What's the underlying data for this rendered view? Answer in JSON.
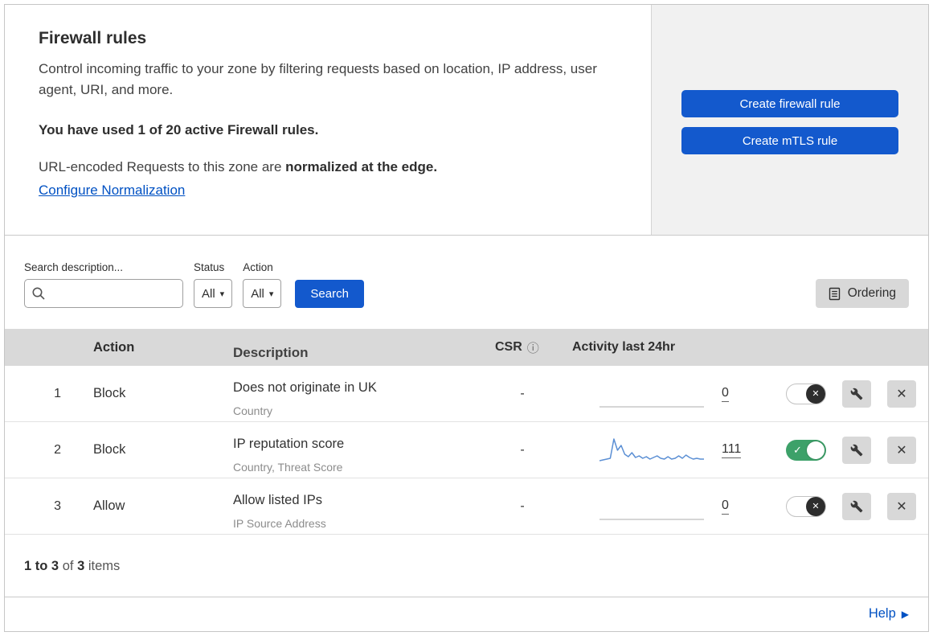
{
  "colors": {
    "primary_button": "#1359cd",
    "link": "#0051c3",
    "toggle_on": "#3da169",
    "sparkline": "#5b8fd4",
    "sparkline_flat": "#c9c9c9"
  },
  "icons": {
    "check": "✓",
    "x": "✕",
    "caret_down": "▾",
    "info": "ⓘ",
    "help_arrow": "▶"
  },
  "header": {
    "title": "Firewall rules",
    "description": "Control incoming traffic to your zone by filtering requests based on location, IP address, user agent, URI, and more.",
    "usage_note": "You have used 1 of 20 active Firewall rules.",
    "normalization_prefix": "URL-encoded Requests to this zone are ",
    "normalization_bold": "normalized at the edge.",
    "normalization_link": "Configure Normalization",
    "create_firewall_button": "Create firewall rule",
    "create_mtls_button": "Create mTLS rule"
  },
  "filters": {
    "search_label": "Search description...",
    "status_label": "Status",
    "status_value": "All",
    "action_label": "Action",
    "action_value": "All",
    "search_button": "Search",
    "ordering_button": "Ordering"
  },
  "table": {
    "headers": {
      "action": "Action",
      "description": "Description",
      "csr": "CSR",
      "activity": "Activity last 24hr"
    },
    "rows": [
      {
        "index": "1",
        "action": "Block",
        "description": "Does not originate in UK",
        "criteria": "Country",
        "csr": "-",
        "activity_count": "0",
        "enabled": false,
        "sparkline": [
          0,
          0,
          0,
          0,
          0,
          0,
          0,
          0,
          0,
          0,
          0,
          0,
          0,
          0,
          0,
          0,
          0,
          0,
          0,
          0
        ]
      },
      {
        "index": "2",
        "action": "Block",
        "description": "IP reputation score",
        "criteria": "Country, Threat Score",
        "csr": "-",
        "activity_count": "111",
        "enabled": true,
        "sparkline": [
          3,
          4,
          5,
          6,
          30,
          16,
          22,
          11,
          8,
          13,
          7,
          9,
          6,
          8,
          5,
          7,
          9,
          6,
          5,
          8,
          5,
          6,
          9,
          6,
          10,
          7,
          5,
          6,
          5,
          5
        ]
      },
      {
        "index": "3",
        "action": "Allow",
        "description": "Allow listed IPs",
        "criteria": "IP Source Address",
        "csr": "-",
        "activity_count": "0",
        "enabled": false,
        "sparkline": [
          0,
          0,
          0,
          0,
          0,
          0,
          0,
          0,
          0,
          0,
          0,
          0,
          0,
          0,
          0,
          0,
          0,
          0,
          0,
          0
        ]
      }
    ]
  },
  "footer": {
    "range": "1 to 3",
    "of_text": "of",
    "total": "3",
    "items_text": "items"
  },
  "help_label": "Help"
}
